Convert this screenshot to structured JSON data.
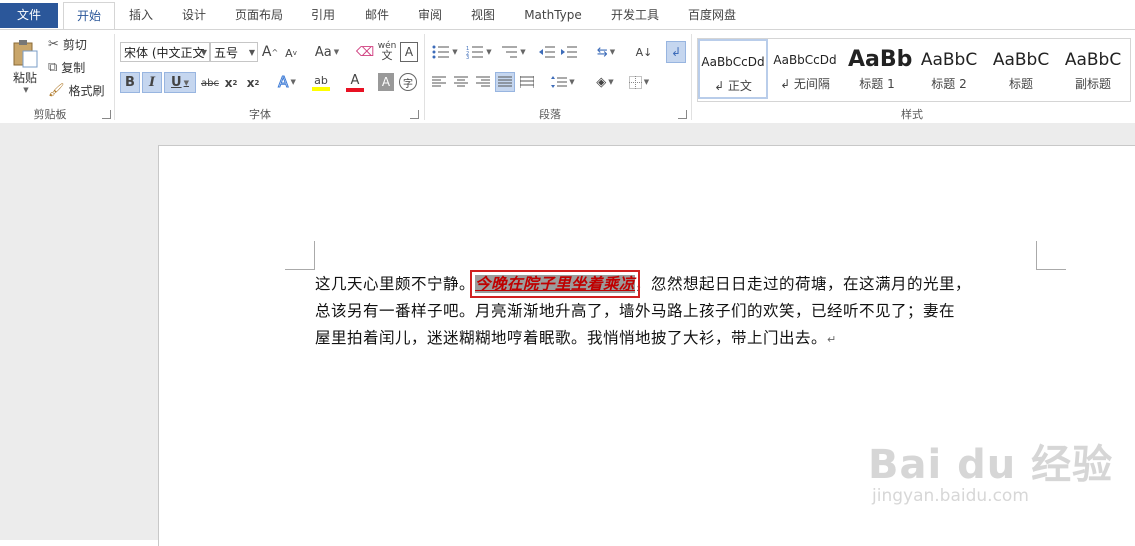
{
  "tabs": {
    "file": "文件",
    "items": [
      "开始",
      "插入",
      "设计",
      "页面布局",
      "引用",
      "邮件",
      "审阅",
      "视图",
      "MathType",
      "开发工具",
      "百度网盘"
    ]
  },
  "clipboard": {
    "paste": "粘贴",
    "cut": "剪切",
    "copy": "复制",
    "format_painter": "格式刷",
    "group_label": "剪贴板"
  },
  "font": {
    "font_name": "宋体 (中文正文",
    "font_size": "五号",
    "grow": "A",
    "shrink": "A",
    "change_case": "Aa",
    "phonetic": "wén",
    "char_border": "A",
    "bold": "B",
    "italic": "I",
    "underline": "U",
    "strikethrough": "abc",
    "subscript": "x",
    "superscript": "x",
    "text_effects": "A",
    "highlight": "ab",
    "font_color": "A",
    "char_shading": "A",
    "enclose": "字",
    "group_label": "字体",
    "highlight_color": "#ffff00",
    "font_color_value": "#e81123"
  },
  "paragraph": {
    "group_label": "段落"
  },
  "styles": {
    "items": [
      {
        "sample": "AaBbCcDd",
        "name": "↲ 正文"
      },
      {
        "sample": "AaBbCcDd",
        "name": "↲ 无间隔"
      },
      {
        "sample": "AaBb",
        "name": "标题 1"
      },
      {
        "sample": "AaBbC",
        "name": "标题 2"
      },
      {
        "sample": "AaBbC",
        "name": "标题"
      },
      {
        "sample": "AaBbC",
        "name": "副标题"
      }
    ],
    "group_label": "样式"
  },
  "document": {
    "line1_before": "这几天心里颇不宁静。",
    "highlighted": "今晚在院子里坐着乘凉",
    "line1_after": "，忽然想起日日走过的荷塘，在这满月的光里，",
    "line2": "总该另有一番样子吧。月亮渐渐地升高了，墙外马路上孩子们的欢笑，已经听不见了；妻在",
    "line3": "屋里拍着闰儿，迷迷糊糊地哼着眠歌。我悄悄地披了大衫，带上门出去。",
    "pilcrow": "↵",
    "highlight_bg": "#9c9c9c",
    "highlight_text_color": "#c00000",
    "callout_border": "#d02020"
  },
  "watermark": {
    "brand": "Bai du 经验",
    "url": "jingyan.baidu.com"
  }
}
